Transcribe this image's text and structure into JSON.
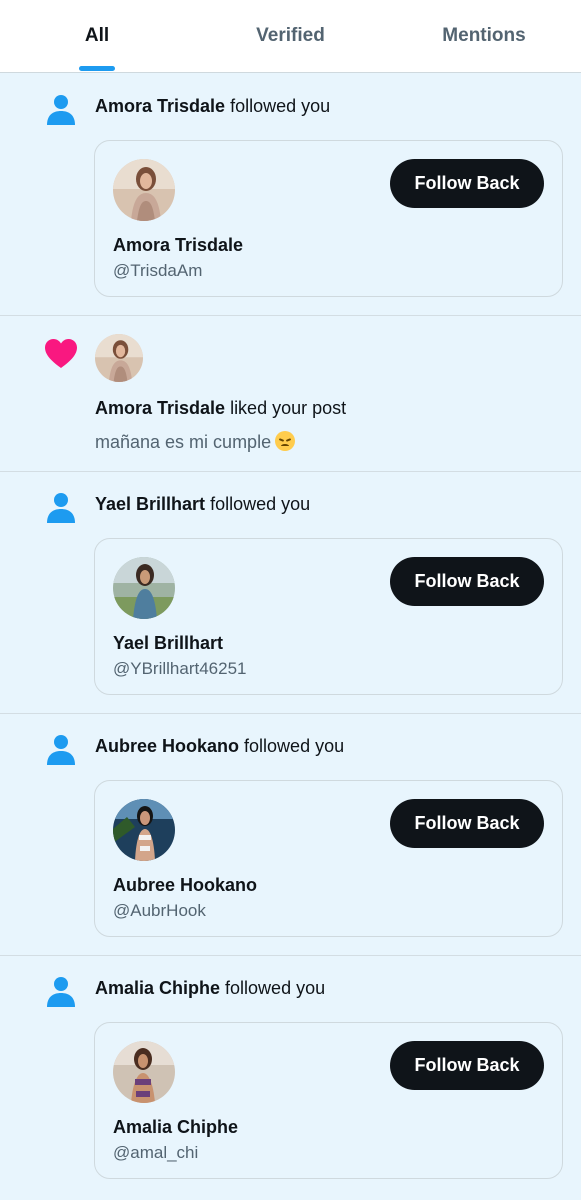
{
  "tabs": [
    {
      "label": "All",
      "active": true
    },
    {
      "label": "Verified",
      "active": false
    },
    {
      "label": "Mentions",
      "active": false
    }
  ],
  "colors": {
    "accent": "#1d9bf0",
    "heart": "#f91880",
    "button": "#0f1419",
    "background": "#e8f5fd"
  },
  "notifications": [
    {
      "type": "follow",
      "icon": "person-icon",
      "actor": "Amora Trisdale",
      "action": " followed you",
      "card": {
        "name": "Amora Trisdale",
        "handle": "@TrisdaAm",
        "button": "Follow Back"
      }
    },
    {
      "type": "like",
      "icon": "heart-icon",
      "actor": "Amora Trisdale",
      "action": " liked your post",
      "post": "mañana es mi cumple"
    },
    {
      "type": "follow",
      "icon": "person-icon",
      "actor": "Yael Brillhart",
      "action": " followed you",
      "card": {
        "name": "Yael Brillhart",
        "handle": "@YBrillhart46251",
        "button": "Follow Back"
      }
    },
    {
      "type": "follow",
      "icon": "person-icon",
      "actor": "Aubree Hookano",
      "action": " followed you",
      "card": {
        "name": "Aubree Hookano",
        "handle": "@AubrHook",
        "button": "Follow Back"
      }
    },
    {
      "type": "follow",
      "icon": "person-icon",
      "actor": "Amalia Chiphe",
      "action": " followed you",
      "card": {
        "name": "Amalia Chiphe",
        "handle": "@amal_chi",
        "button": "Follow Back"
      }
    }
  ]
}
